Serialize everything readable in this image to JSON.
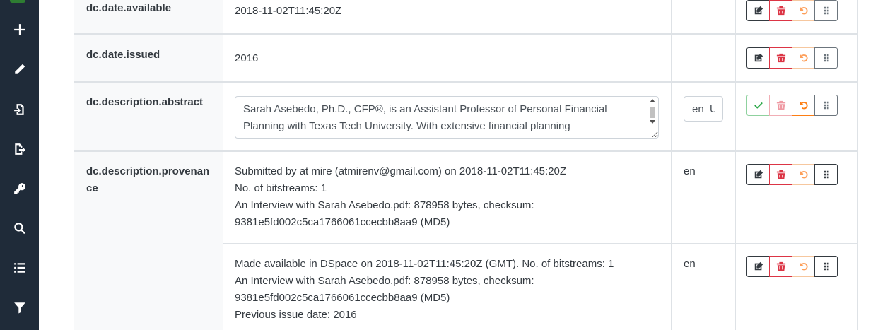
{
  "sidebar": {
    "icons": [
      "plus-icon",
      "pencil-icon",
      "file-import-icon",
      "file-export-icon",
      "key-icon",
      "search-icon",
      "list-icon",
      "filter-icon"
    ]
  },
  "rows": {
    "available": {
      "key": "dc.date.available",
      "value": "2018-11-02T11:45:20Z",
      "lang": ""
    },
    "issued": {
      "key": "dc.date.issued",
      "value": "2016",
      "lang": ""
    },
    "abstract": {
      "key": "dc.description.abstract",
      "value": "Sarah Asebedo, Ph.D., CFP®, is an Assistant Professor of Personal Financial Planning with Texas Tech University. With extensive financial planning",
      "lang": "en_US"
    },
    "provenance": {
      "key": "dc.description.provenance",
      "values": [
        {
          "lines": [
            "Submitted by at mire (atmirenv@gmail.com) on 2018-11-02T11:45:20Z",
            "No. of bitstreams: 1",
            "An Interview with Sarah Asebedo.pdf: 878958 bytes, checksum:",
            "9381e5fd002c5ca1766061ccecbb8aa9 (MD5)"
          ],
          "lang": "en"
        },
        {
          "lines": [
            "Made available in DSpace on 2018-11-02T11:45:20Z (GMT). No. of bitstreams: 1",
            "An Interview with Sarah Asebedo.pdf: 878958 bytes, checksum:",
            "9381e5fd002c5ca1766061ccecbb8aa9 (MD5)",
            "Previous issue date: 2016"
          ],
          "lang": "en"
        }
      ]
    }
  },
  "colors": {
    "sidebar": "#1f2b39",
    "key_bg": "#f8f9fa",
    "danger": "#dc3545",
    "warning": "#fd7e14",
    "success": "#28a745",
    "dark": "#343a40"
  }
}
